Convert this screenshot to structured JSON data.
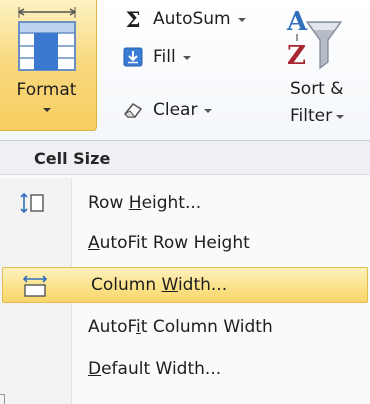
{
  "ribbon": {
    "format": {
      "label": "Format",
      "icon": "format-cells-icon"
    },
    "autosum": {
      "label": "AutoSum",
      "symbol": "Σ",
      "icon": "autosum-icon"
    },
    "fill": {
      "label": "Fill",
      "icon": "fill-down-icon"
    },
    "clear": {
      "label": "Clear",
      "icon": "eraser-icon"
    },
    "sort_filter": {
      "label_line1": "Sort &",
      "label_line2": "Filter",
      "icon": "sort-filter-icon"
    }
  },
  "menu": {
    "section_title": "Cell Size",
    "items": [
      {
        "pre": "Row ",
        "key": "H",
        "post": "eight...",
        "icon": "row-height-icon"
      },
      {
        "pre": "",
        "key": "A",
        "post": "utoFit Row Height",
        "icon": ""
      },
      {
        "pre": "Column ",
        "key": "W",
        "post": "idth...",
        "icon": "column-width-icon"
      },
      {
        "pre": "AutoF",
        "key": "i",
        "post": "t Column Width",
        "icon": ""
      },
      {
        "pre": "",
        "key": "D",
        "post": "efault Width...",
        "icon": ""
      }
    ]
  },
  "colors": {
    "highlight": "#fbe48e",
    "highlight_border": "#e3bd4f",
    "ribbon_bg": "#f4f7fb",
    "accent_blue": "#2f6fbd"
  }
}
